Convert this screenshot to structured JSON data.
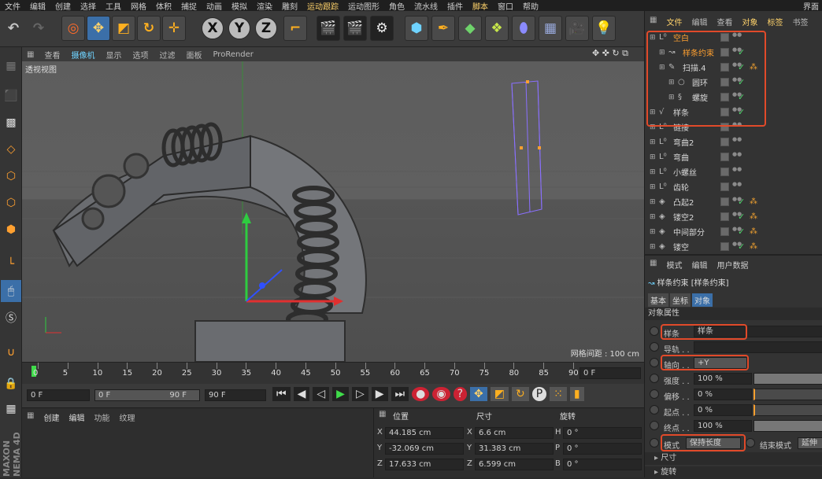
{
  "menubar": {
    "items": [
      "文件",
      "编辑",
      "创建",
      "选择",
      "工具",
      "网格",
      "体积",
      "捕捉",
      "动画",
      "模拟",
      "渲染",
      "雕刻",
      "运动跟踪",
      "运动图形",
      "角色",
      "流水线",
      "插件",
      "脚本",
      "窗口",
      "帮助"
    ],
    "right_label": "界面"
  },
  "viewport_menu": {
    "items": [
      "查看",
      "摄像机",
      "显示",
      "选项",
      "过滤",
      "面板",
      "ProRender"
    ],
    "active_index": 1
  },
  "viewport": {
    "label": "透视视图",
    "grid_spacing": "网格间距 : 100 cm"
  },
  "timeline": {
    "ticks": [
      "0",
      "5",
      "10",
      "15",
      "20",
      "25",
      "30",
      "35",
      "40",
      "45",
      "50",
      "55",
      "60",
      "65",
      "70",
      "75",
      "80",
      "85",
      "90"
    ],
    "current_frame": "0 F"
  },
  "transport": {
    "start_field": "0 F",
    "range_start": "0 F",
    "range_end": "90 F",
    "end_field": "90 F"
  },
  "bottom_left": {
    "tabs": [
      "创建",
      "编辑",
      "功能",
      "纹理"
    ]
  },
  "coords": {
    "headers": [
      "位置",
      "尺寸",
      "旋转"
    ],
    "rows": [
      {
        "axis": "X",
        "pos": "44.185 cm",
        "size_axis": "X",
        "size": "6.6 cm",
        "rot_axis": "H",
        "rot": "0 °"
      },
      {
        "axis": "Y",
        "pos": "-32.069 cm",
        "size_axis": "Y",
        "size": "31.383 cm",
        "rot_axis": "P",
        "rot": "0 °"
      },
      {
        "axis": "Z",
        "pos": "17.633 cm",
        "size_axis": "Z",
        "size": "6.599 cm",
        "rot_axis": "B",
        "rot": "0 °"
      }
    ]
  },
  "object_manager": {
    "menu": [
      "文件",
      "编辑",
      "查看",
      "对象",
      "标签",
      "书签"
    ],
    "objects": [
      {
        "name": "空白",
        "icon": "L⁰",
        "indent": 0,
        "highlight": true,
        "check": false,
        "tag": false
      },
      {
        "name": "样条约束",
        "icon": "↝",
        "indent": 1,
        "highlight": true,
        "check": true,
        "tag": false
      },
      {
        "name": "扫描.4",
        "icon": "✎",
        "indent": 1,
        "highlight": false,
        "check": true,
        "tag": true
      },
      {
        "name": "圆环",
        "icon": "○",
        "indent": 2,
        "highlight": false,
        "check": true,
        "tag": false
      },
      {
        "name": "螺旋",
        "icon": "§",
        "indent": 2,
        "highlight": false,
        "check": true,
        "tag": false
      },
      {
        "name": "样条",
        "icon": "√",
        "indent": 0,
        "highlight": false,
        "check": true,
        "tag": false
      },
      {
        "name": "链接",
        "icon": "L⁰",
        "indent": 0,
        "highlight": false,
        "check": false,
        "tag": false
      },
      {
        "name": "弯曲2",
        "icon": "L⁰",
        "indent": 0,
        "highlight": false,
        "check": false,
        "tag": false
      },
      {
        "name": "弯曲",
        "icon": "L⁰",
        "indent": 0,
        "highlight": false,
        "check": false,
        "tag": false
      },
      {
        "name": "小螺丝",
        "icon": "L⁰",
        "indent": 0,
        "highlight": false,
        "check": false,
        "tag": false
      },
      {
        "name": "齿轮",
        "icon": "L⁰",
        "indent": 0,
        "highlight": false,
        "check": false,
        "tag": false
      },
      {
        "name": "凸起2",
        "icon": "◈",
        "indent": 0,
        "highlight": false,
        "check": true,
        "tag": true
      },
      {
        "name": "镂空2",
        "icon": "◈",
        "indent": 0,
        "highlight": false,
        "check": true,
        "tag": true
      },
      {
        "name": "中间部分",
        "icon": "◈",
        "indent": 0,
        "highlight": false,
        "check": true,
        "tag": true
      },
      {
        "name": "镂空",
        "icon": "◈",
        "indent": 0,
        "highlight": false,
        "check": true,
        "tag": true
      }
    ]
  },
  "attributes": {
    "menu": [
      "模式",
      "编辑",
      "用户数据"
    ],
    "title": "样条约束 [样条约束]",
    "tabs": [
      "基本",
      "坐标",
      "对象"
    ],
    "active_tab": 2,
    "section": "对象属性",
    "spline_label": "样条",
    "spline_value": "样条",
    "rail_label": "导轨 . .",
    "axis_label": "轴向 . .",
    "axis_value": "+Y",
    "strength_label": "强度 . .",
    "strength_value": "100 %",
    "offset_label": "偏移 . .",
    "offset_value": "0 %",
    "start_label": "起点 . .",
    "start_value": "0 %",
    "end_label": "终点 . .",
    "end_value": "100 %",
    "mode_label": "模式",
    "mode_value": "保持长度",
    "end_mode_label": "结束模式",
    "end_mode_value": "延伸",
    "collapsed": [
      "尺寸",
      "旋转"
    ]
  },
  "colors": {
    "accent_blue": "#6fd3ff",
    "highlight_orange": "#f0a030",
    "red_outline": "#e14a2a",
    "check_green": "#4fd26b"
  }
}
